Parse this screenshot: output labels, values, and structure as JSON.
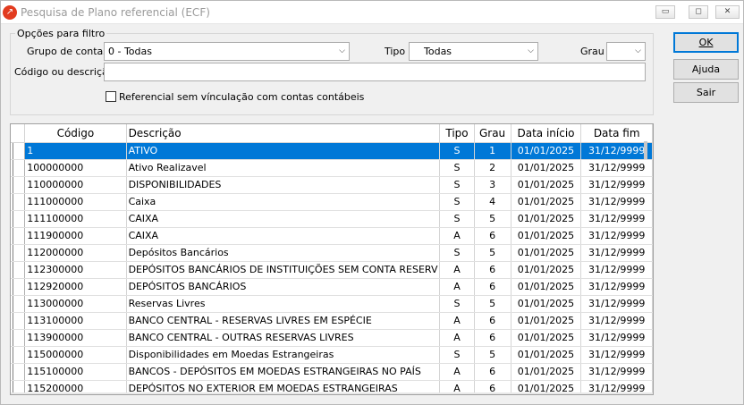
{
  "window": {
    "title": "Pesquisa de Plano referencial (ECF)",
    "minimize_glyph": "▭",
    "restore_glyph": "◻",
    "close_glyph": "✕"
  },
  "filter": {
    "legend": "Opções para filtro",
    "grupo_label": "Grupo de contas",
    "grupo_value": "0 - Todas",
    "tipo_label": "Tipo",
    "tipo_value": "Todas",
    "grau_label": "Grau",
    "grau_value": "",
    "codigo_label": "Código ou descrição",
    "codigo_value": "",
    "checkbox_label": "Referencial sem vínculação com contas contábeis"
  },
  "buttons": {
    "ok": "OK",
    "ajuda": "Ajuda",
    "sair": "Sair"
  },
  "grid": {
    "columns": [
      "Código",
      "Descrição",
      "Tipo",
      "Grau",
      "Data início",
      "Data fim"
    ],
    "rows": [
      {
        "codigo": "1",
        "descricao": "ATIVO",
        "tipo": "S",
        "grau": "1",
        "inicio": "01/01/2025",
        "fim": "31/12/9999",
        "selected": true
      },
      {
        "codigo": "100000000",
        "descricao": "Ativo Realizavel",
        "tipo": "S",
        "grau": "2",
        "inicio": "01/01/2025",
        "fim": "31/12/9999"
      },
      {
        "codigo": "110000000",
        "descricao": "DISPONIBILIDADES",
        "tipo": "S",
        "grau": "3",
        "inicio": "01/01/2025",
        "fim": "31/12/9999"
      },
      {
        "codigo": "111000000",
        "descricao": "Caixa",
        "tipo": "S",
        "grau": "4",
        "inicio": "01/01/2025",
        "fim": "31/12/9999"
      },
      {
        "codigo": "111100000",
        "descricao": "CAIXA",
        "tipo": "S",
        "grau": "5",
        "inicio": "01/01/2025",
        "fim": "31/12/9999"
      },
      {
        "codigo": "111900000",
        "descricao": "CAIXA",
        "tipo": "A",
        "grau": "6",
        "inicio": "01/01/2025",
        "fim": "31/12/9999"
      },
      {
        "codigo": "112000000",
        "descricao": "Depósitos Bancários",
        "tipo": "S",
        "grau": "5",
        "inicio": "01/01/2025",
        "fim": "31/12/9999"
      },
      {
        "codigo": "112300000",
        "descricao": "DEPÓSITOS BANCÁRIOS DE INSTITUIÇÕES SEM CONTA RESERV",
        "tipo": "A",
        "grau": "6",
        "inicio": "01/01/2025",
        "fim": "31/12/9999"
      },
      {
        "codigo": "112920000",
        "descricao": "DEPÓSITOS BANCÁRIOS",
        "tipo": "A",
        "grau": "6",
        "inicio": "01/01/2025",
        "fim": "31/12/9999"
      },
      {
        "codigo": "113000000",
        "descricao": "Reservas Livres",
        "tipo": "S",
        "grau": "5",
        "inicio": "01/01/2025",
        "fim": "31/12/9999"
      },
      {
        "codigo": "113100000",
        "descricao": "BANCO CENTRAL - RESERVAS LIVRES EM ESPÉCIE",
        "tipo": "A",
        "grau": "6",
        "inicio": "01/01/2025",
        "fim": "31/12/9999"
      },
      {
        "codigo": "113900000",
        "descricao": "BANCO CENTRAL - OUTRAS RESERVAS LIVRES",
        "tipo": "A",
        "grau": "6",
        "inicio": "01/01/2025",
        "fim": "31/12/9999"
      },
      {
        "codigo": "115000000",
        "descricao": "Disponibilidades em Moedas Estrangeiras",
        "tipo": "S",
        "grau": "5",
        "inicio": "01/01/2025",
        "fim": "31/12/9999"
      },
      {
        "codigo": "115100000",
        "descricao": "BANCOS - DEPÓSITOS EM MOEDAS ESTRANGEIRAS NO PAÍS",
        "tipo": "A",
        "grau": "6",
        "inicio": "01/01/2025",
        "fim": "31/12/9999"
      },
      {
        "codigo": "115200000",
        "descricao": "DEPÓSITOS NO EXTERIOR EM MOEDAS ESTRANGEIRAS",
        "tipo": "A",
        "grau": "6",
        "inicio": "01/01/2025",
        "fim": "31/12/9999"
      }
    ]
  },
  "colors": {
    "selection": "#0078d7",
    "app_icon": "#e23b1f"
  }
}
